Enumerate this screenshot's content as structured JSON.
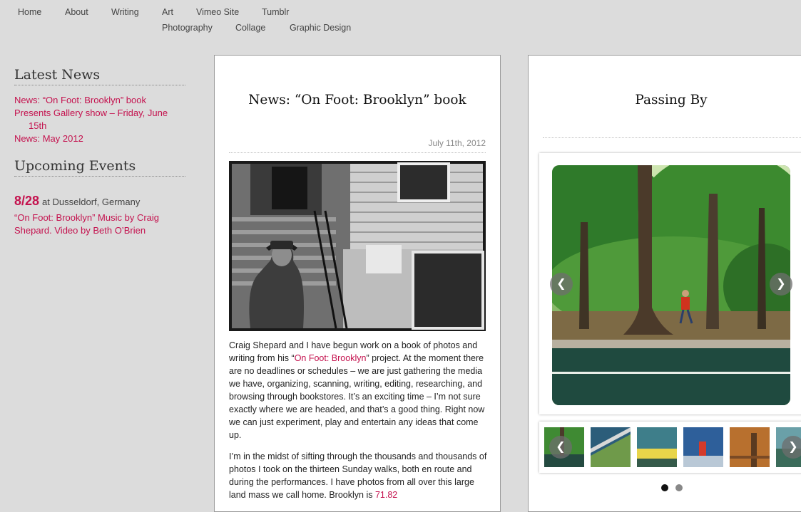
{
  "nav": {
    "row1": [
      "Home",
      "About",
      "Writing",
      "Art",
      "Vimeo Site",
      "Tumblr"
    ],
    "row2": [
      "Photography",
      "Collage",
      "Graphic Design"
    ]
  },
  "sidebar": {
    "latest_news": {
      "heading": "Latest News",
      "items": [
        "News: “On Foot: Brooklyn” book",
        "Presents Gallery show – Friday, June 15th",
        "News: May 2012"
      ]
    },
    "upcoming_events": {
      "heading": "Upcoming Events",
      "date": "8/28",
      "location": "at Dusseldorf, Germany",
      "link": "“On Foot: Brooklyn” Music by Craig Shepard. Video by Beth O’Brien"
    }
  },
  "post": {
    "title": "News: “On Foot: Brooklyn” book",
    "date": "July 11th, 2012",
    "p1_before": "Craig Shepard and I have begun work on a book of photos and writing from his “",
    "p1_link": "On Foot: Brooklyn",
    "p1_after": "” project. At the moment there are no deadlines or schedules – we are just gathering the media we have, organizing, scanning, writing, editing, researching, and browsing through bookstores. It’s an exciting time – I’m not sure exactly where we are headed, and that’s a good thing. Right now we can just experiment, play and entertain any ideas that come up.",
    "p2_before": "I’m in the midst of sifting through the thousands and thousands of photos I took on the thirteen Sunday walks, both en route and during the performances. I have photos from all over this large land mass we call home. Brooklyn is ",
    "p2_link": "71.82"
  },
  "gallery": {
    "title": "Passing By",
    "prev_icon": "chevron-left-icon",
    "next_icon": "chevron-right-icon",
    "active_dot": 0
  },
  "colors": {
    "accent": "#c4124e",
    "page_bg": "#dcdcdc"
  }
}
